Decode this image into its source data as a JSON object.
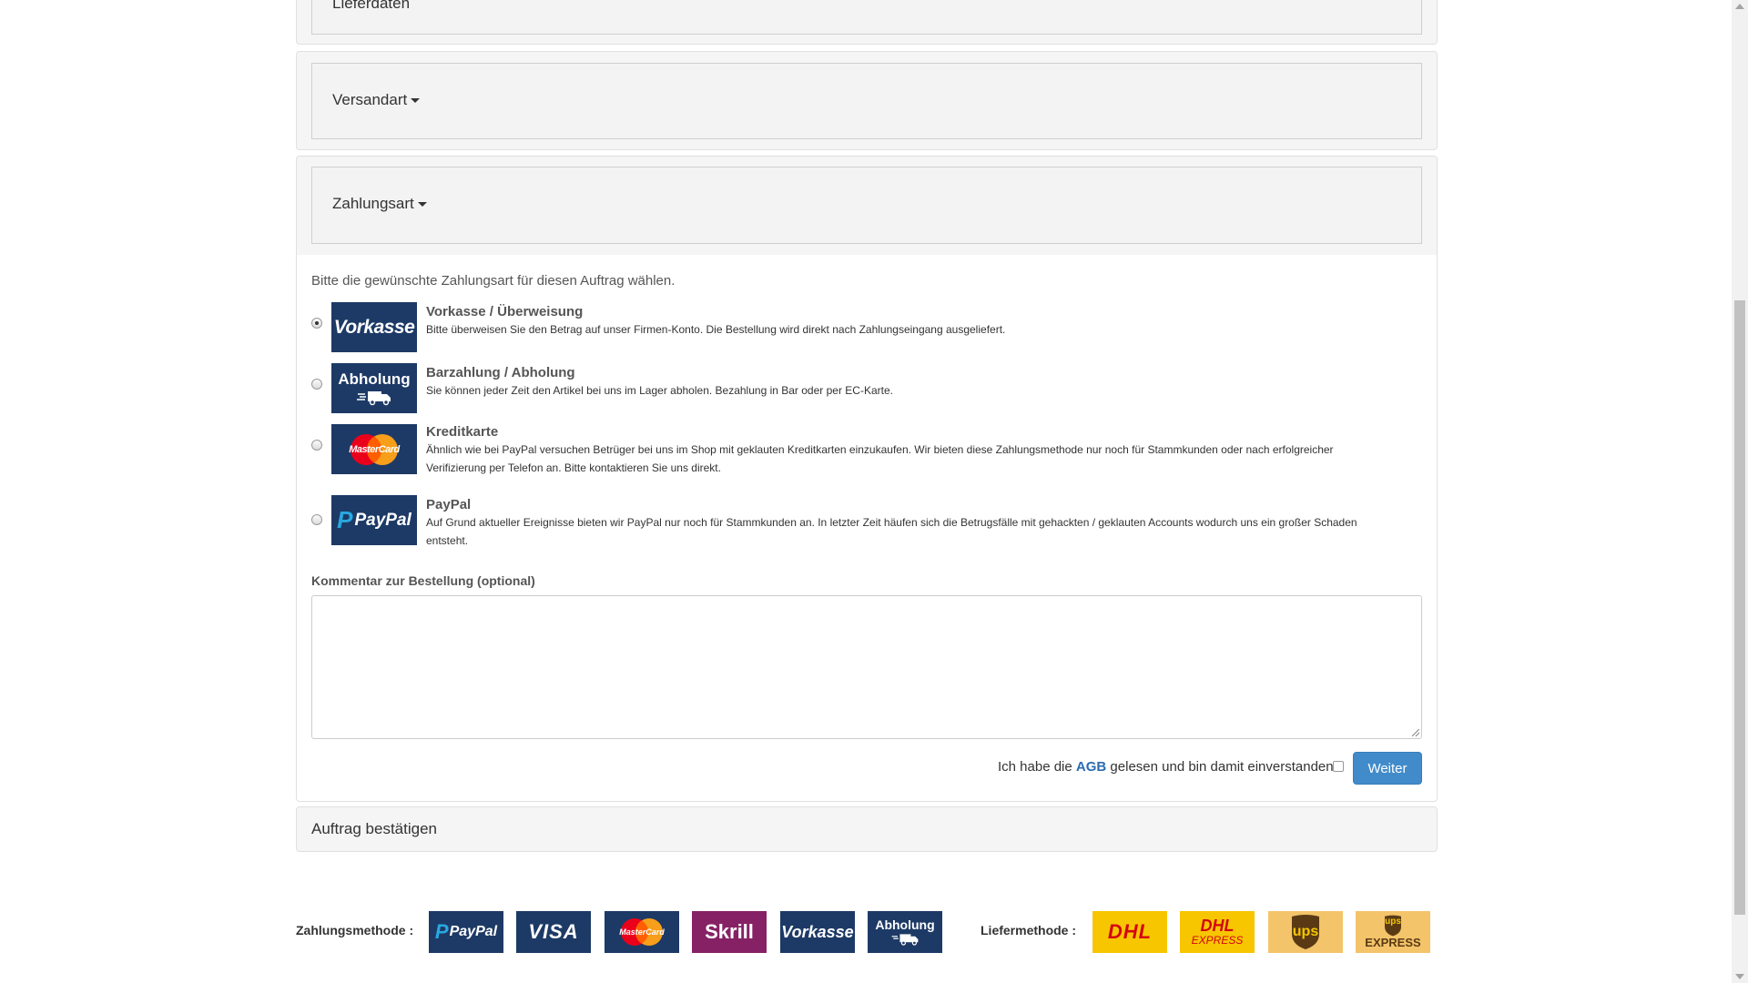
{
  "sections": {
    "lieferdaten": "Lieferdaten",
    "versandart": "Versandart",
    "zahlungsart": "Zahlungsart"
  },
  "payment": {
    "intro": "Bitte die gewünschte Zahlungsart für diesen Auftrag wählen.",
    "options": [
      {
        "logo": "Vorkasse",
        "title": "Vorkasse / Überweisung",
        "desc": "Bitte überweisen Sie den Betrag auf unser Firmen-Konto. Die Bestellung wird direkt nach Zahlungseingang ausgeliefert.",
        "selected": true
      },
      {
        "logo": "Abholung",
        "title": "Barzahlung / Abholung",
        "desc": "Sie können jeder Zeit den Artikel bei uns im Lager abholen. Bezahlung in Bar oder per EC-Karte.",
        "selected": false
      },
      {
        "logo": "MasterCard",
        "title": "Kreditkarte",
        "desc": "Ähnlich wie bei PayPal versuchen Betrüger bei uns im Shop mit geklauten Kreditkarten einzukaufen. Wir bieten diese Zahlungsmethode nur noch für Stammkunden oder nach erfolgreicher Verifizierung per Telefon an. Bitte kontaktieren Sie uns direkt.",
        "selected": false
      },
      {
        "logo": "PayPal",
        "title": "PayPal",
        "desc": "Auf Grund aktueller Ereignisse bieten wir PayPal nur noch für Stammkunden an. In letzter Zeit häufen sich die Betrugsfälle mit gehackten / geklauten Accounts wodurch uns ein großer Schaden entsteht.",
        "selected": false
      }
    ],
    "comment_label": "Kommentar zur Bestellung (optional)",
    "comment_value": "",
    "agb_prefix": "Ich habe die",
    "agb_link": "AGB",
    "agb_suffix": "gelesen und bin damit einverstanden.",
    "agb_checked": false,
    "weiter": "Weiter"
  },
  "confirm": {
    "title": "Auftrag bestätigen"
  },
  "footer": {
    "payment_label": "Zahlungsmethode :",
    "shipping_label": "Liefermethode :",
    "payment_logos": [
      "PayPal",
      "VISA",
      "MasterCard",
      "Skrill",
      "Vorkasse",
      "Abholung"
    ],
    "shipping_logos": [
      "DHL",
      "DHL",
      "EXPRESS",
      "ups",
      "ups",
      "EXPRESS"
    ]
  },
  "colors": {
    "primary": "#428bca",
    "logo_navy": "#1d3a66",
    "skrill": "#862165",
    "dhl_yellow": "#f7c600",
    "dhl_red": "#d40511",
    "ups_brown": "#5a3a14"
  }
}
